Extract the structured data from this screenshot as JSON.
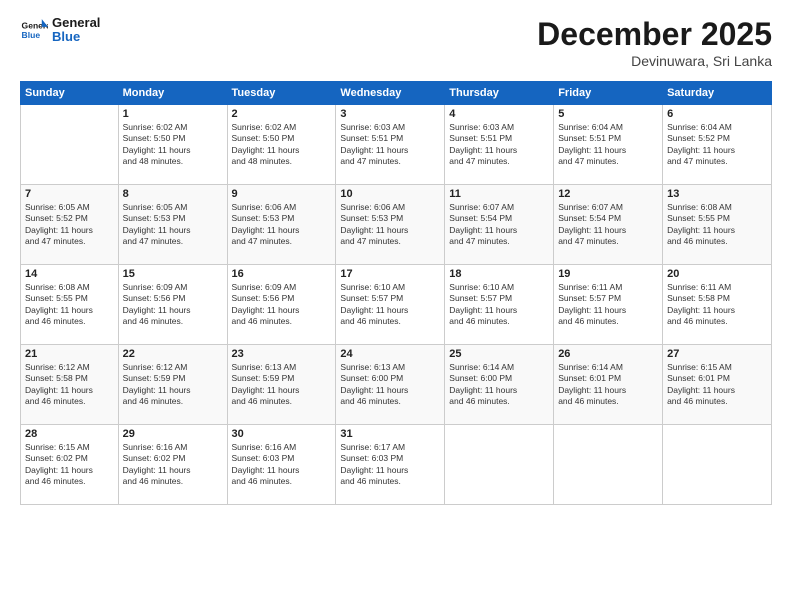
{
  "header": {
    "logo_line1": "General",
    "logo_line2": "Blue",
    "month": "December 2025",
    "location": "Devinuwara, Sri Lanka"
  },
  "weekdays": [
    "Sunday",
    "Monday",
    "Tuesday",
    "Wednesday",
    "Thursday",
    "Friday",
    "Saturday"
  ],
  "weeks": [
    [
      {
        "day": "",
        "info": ""
      },
      {
        "day": "1",
        "info": "Sunrise: 6:02 AM\nSunset: 5:50 PM\nDaylight: 11 hours\nand 48 minutes."
      },
      {
        "day": "2",
        "info": "Sunrise: 6:02 AM\nSunset: 5:50 PM\nDaylight: 11 hours\nand 48 minutes."
      },
      {
        "day": "3",
        "info": "Sunrise: 6:03 AM\nSunset: 5:51 PM\nDaylight: 11 hours\nand 47 minutes."
      },
      {
        "day": "4",
        "info": "Sunrise: 6:03 AM\nSunset: 5:51 PM\nDaylight: 11 hours\nand 47 minutes."
      },
      {
        "day": "5",
        "info": "Sunrise: 6:04 AM\nSunset: 5:51 PM\nDaylight: 11 hours\nand 47 minutes."
      },
      {
        "day": "6",
        "info": "Sunrise: 6:04 AM\nSunset: 5:52 PM\nDaylight: 11 hours\nand 47 minutes."
      }
    ],
    [
      {
        "day": "7",
        "info": "Sunrise: 6:05 AM\nSunset: 5:52 PM\nDaylight: 11 hours\nand 47 minutes."
      },
      {
        "day": "8",
        "info": "Sunrise: 6:05 AM\nSunset: 5:53 PM\nDaylight: 11 hours\nand 47 minutes."
      },
      {
        "day": "9",
        "info": "Sunrise: 6:06 AM\nSunset: 5:53 PM\nDaylight: 11 hours\nand 47 minutes."
      },
      {
        "day": "10",
        "info": "Sunrise: 6:06 AM\nSunset: 5:53 PM\nDaylight: 11 hours\nand 47 minutes."
      },
      {
        "day": "11",
        "info": "Sunrise: 6:07 AM\nSunset: 5:54 PM\nDaylight: 11 hours\nand 47 minutes."
      },
      {
        "day": "12",
        "info": "Sunrise: 6:07 AM\nSunset: 5:54 PM\nDaylight: 11 hours\nand 47 minutes."
      },
      {
        "day": "13",
        "info": "Sunrise: 6:08 AM\nSunset: 5:55 PM\nDaylight: 11 hours\nand 46 minutes."
      }
    ],
    [
      {
        "day": "14",
        "info": "Sunrise: 6:08 AM\nSunset: 5:55 PM\nDaylight: 11 hours\nand 46 minutes."
      },
      {
        "day": "15",
        "info": "Sunrise: 6:09 AM\nSunset: 5:56 PM\nDaylight: 11 hours\nand 46 minutes."
      },
      {
        "day": "16",
        "info": "Sunrise: 6:09 AM\nSunset: 5:56 PM\nDaylight: 11 hours\nand 46 minutes."
      },
      {
        "day": "17",
        "info": "Sunrise: 6:10 AM\nSunset: 5:57 PM\nDaylight: 11 hours\nand 46 minutes."
      },
      {
        "day": "18",
        "info": "Sunrise: 6:10 AM\nSunset: 5:57 PM\nDaylight: 11 hours\nand 46 minutes."
      },
      {
        "day": "19",
        "info": "Sunrise: 6:11 AM\nSunset: 5:57 PM\nDaylight: 11 hours\nand 46 minutes."
      },
      {
        "day": "20",
        "info": "Sunrise: 6:11 AM\nSunset: 5:58 PM\nDaylight: 11 hours\nand 46 minutes."
      }
    ],
    [
      {
        "day": "21",
        "info": "Sunrise: 6:12 AM\nSunset: 5:58 PM\nDaylight: 11 hours\nand 46 minutes."
      },
      {
        "day": "22",
        "info": "Sunrise: 6:12 AM\nSunset: 5:59 PM\nDaylight: 11 hours\nand 46 minutes."
      },
      {
        "day": "23",
        "info": "Sunrise: 6:13 AM\nSunset: 5:59 PM\nDaylight: 11 hours\nand 46 minutes."
      },
      {
        "day": "24",
        "info": "Sunrise: 6:13 AM\nSunset: 6:00 PM\nDaylight: 11 hours\nand 46 minutes."
      },
      {
        "day": "25",
        "info": "Sunrise: 6:14 AM\nSunset: 6:00 PM\nDaylight: 11 hours\nand 46 minutes."
      },
      {
        "day": "26",
        "info": "Sunrise: 6:14 AM\nSunset: 6:01 PM\nDaylight: 11 hours\nand 46 minutes."
      },
      {
        "day": "27",
        "info": "Sunrise: 6:15 AM\nSunset: 6:01 PM\nDaylight: 11 hours\nand 46 minutes."
      }
    ],
    [
      {
        "day": "28",
        "info": "Sunrise: 6:15 AM\nSunset: 6:02 PM\nDaylight: 11 hours\nand 46 minutes."
      },
      {
        "day": "29",
        "info": "Sunrise: 6:16 AM\nSunset: 6:02 PM\nDaylight: 11 hours\nand 46 minutes."
      },
      {
        "day": "30",
        "info": "Sunrise: 6:16 AM\nSunset: 6:03 PM\nDaylight: 11 hours\nand 46 minutes."
      },
      {
        "day": "31",
        "info": "Sunrise: 6:17 AM\nSunset: 6:03 PM\nDaylight: 11 hours\nand 46 minutes."
      },
      {
        "day": "",
        "info": ""
      },
      {
        "day": "",
        "info": ""
      },
      {
        "day": "",
        "info": ""
      }
    ]
  ]
}
